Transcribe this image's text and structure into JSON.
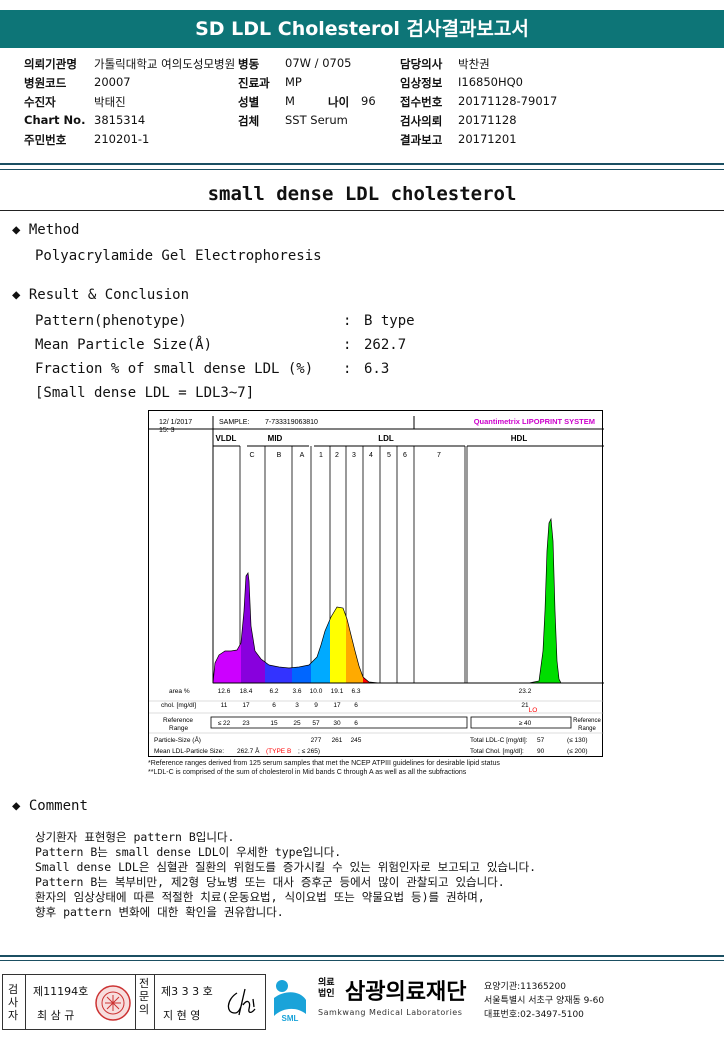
{
  "header": {
    "title": "SD LDL Cholesterol 검사결과보고서"
  },
  "patient_info": {
    "rows": [
      [
        {
          "label": "의뢰기관명",
          "value": "가톨릭대학교 여의도성모병원"
        },
        {
          "label": "병동",
          "value": "07W / 0705"
        },
        {
          "label": "담당의사",
          "value": "박찬권"
        }
      ],
      [
        {
          "label": "병원코드",
          "value": "20007"
        },
        {
          "label": "진료과",
          "value": "MP"
        },
        {
          "label": "임상정보",
          "value": "I16850HQ0"
        }
      ],
      [
        {
          "label": "수진자",
          "value": "박태진"
        },
        {
          "label": "성별",
          "value": "M"
        },
        {
          "label": "나이",
          "value": "96"
        },
        {
          "label": "접수번호",
          "value": "20171128-79017"
        }
      ],
      [
        {
          "label": "Chart No.",
          "value": "3815314"
        },
        {
          "label": "검체",
          "value": "SST Serum"
        },
        {
          "label": "검사의뢰",
          "value": "20171128"
        }
      ],
      [
        {
          "label": "주민번호",
          "value": "210201-1"
        },
        {
          "label": "결과보고",
          "value": "20171201"
        }
      ]
    ]
  },
  "report": {
    "title": "small dense LDL cholesterol",
    "method_heading": "Method",
    "method_value": "Polyacrylamide Gel Electrophoresis",
    "result_heading": "Result & Conclusion",
    "results": [
      {
        "label": "Pattern(phenotype)",
        "value": "B type"
      },
      {
        "label": "Mean Particle Size(Å)",
        "value": "262.7"
      },
      {
        "label": "Fraction % of small dense LDL (%)",
        "value": "6.3"
      }
    ],
    "note": "[Small dense LDL = LDL3~7]",
    "comment_heading": "Comment",
    "comment_lines": [
      "상기환자 표현형은 pattern B입니다.",
      "Pattern B는 small dense LDL이 우세한 type입니다.",
      "Small dense LDL은 심혈관 질환의 위험도를 증가시킬 수 있는 위험인자로 보고되고 있습니다.",
      "Pattern B는 복부비만, 제2형 당뇨병 또는 대사 증후군 등에서 많이 관찰되고 있습니다.",
      "환자의 임상상태에 따른 적절한 치료(운동요법, 식이요법 또는 약물요법 등)를 권하며,",
      "향후 pattern 변화에 대한 확인을 권유합니다."
    ]
  },
  "chart_data": {
    "type": "area",
    "title": "Quantimetrix LIPOPRINT SYSTEM",
    "date_text": "12/ 1/2017",
    "time_text": "15: 3",
    "sample_label": "SAMPLE:",
    "sample_id": "7-733319063810",
    "bands": [
      "C",
      "B",
      "A",
      "1",
      "2",
      "3",
      "4",
      "5",
      "6",
      "7"
    ],
    "groups": [
      "VLDL",
      "MID",
      "LDL",
      "HDL"
    ],
    "band_colors": [
      "#cc00ff",
      "#8800dd",
      "#3333ff",
      "#0066ff",
      "#00aaff",
      "#ffff00",
      "#ffaa00",
      "#ff0000",
      "#00dd00"
    ],
    "table": {
      "area_label": "area %",
      "area_values": [
        "12.6",
        "18.4",
        "6.2",
        "3.6",
        "10.0",
        "19.1",
        "6.3",
        "23.2"
      ],
      "chol_label": "chol. [mg/dl]",
      "chol_values": [
        "11",
        "17",
        "6",
        "3",
        "9",
        "17",
        "6",
        "21"
      ],
      "chol_flag": "LO",
      "ref_label_1": "Reference",
      "ref_label_2": "Range",
      "ref_values": [
        "≤ 22",
        "23",
        "15",
        "25",
        "57",
        "30",
        "6",
        "≥ 40"
      ],
      "particle_label": "Particle-Size (Å)",
      "particle_values": [
        "277",
        "261",
        "245"
      ],
      "mean_label": "Mean LDL-Particle Size:",
      "mean_value": "262.7 Å",
      "mean_type": "(TYPE B",
      "mean_ref": "; ≤ 265)",
      "total_ldl_label": "Total LDL-C [mg/dl]:",
      "total_ldl_value": "57",
      "total_ldl_ref": "(≤ 130)",
      "total_chol_label": "Total Chol. [mg/dl]:",
      "total_chol_value": "90",
      "total_chol_ref": "(≤ 200)"
    },
    "footnotes": [
      "*Reference ranges derived from 125 serum samples that met the NCEP ATPIII guidelines for desirable lipid status",
      "**LDL-C is comprised of the sum of cholesterol in Mid bands C through A as well as all the subfractions"
    ]
  },
  "signature": {
    "role1": "검사자",
    "id1": "제11194호",
    "name1": "최 삼 규",
    "role2": "전문의",
    "id2": "제3 3 3 호",
    "name2": "지 현 영"
  },
  "organization": {
    "type_line1": "의료",
    "type_line2": "법인",
    "name": "삼광의료재단",
    "english": "Samkwang Medical Laboratories",
    "logo_text": "SML",
    "info_lines": [
      "요양기관:11365200",
      "서울특별시 서초구 양재동 9-60",
      "대표번호:02-3497-5100"
    ]
  }
}
